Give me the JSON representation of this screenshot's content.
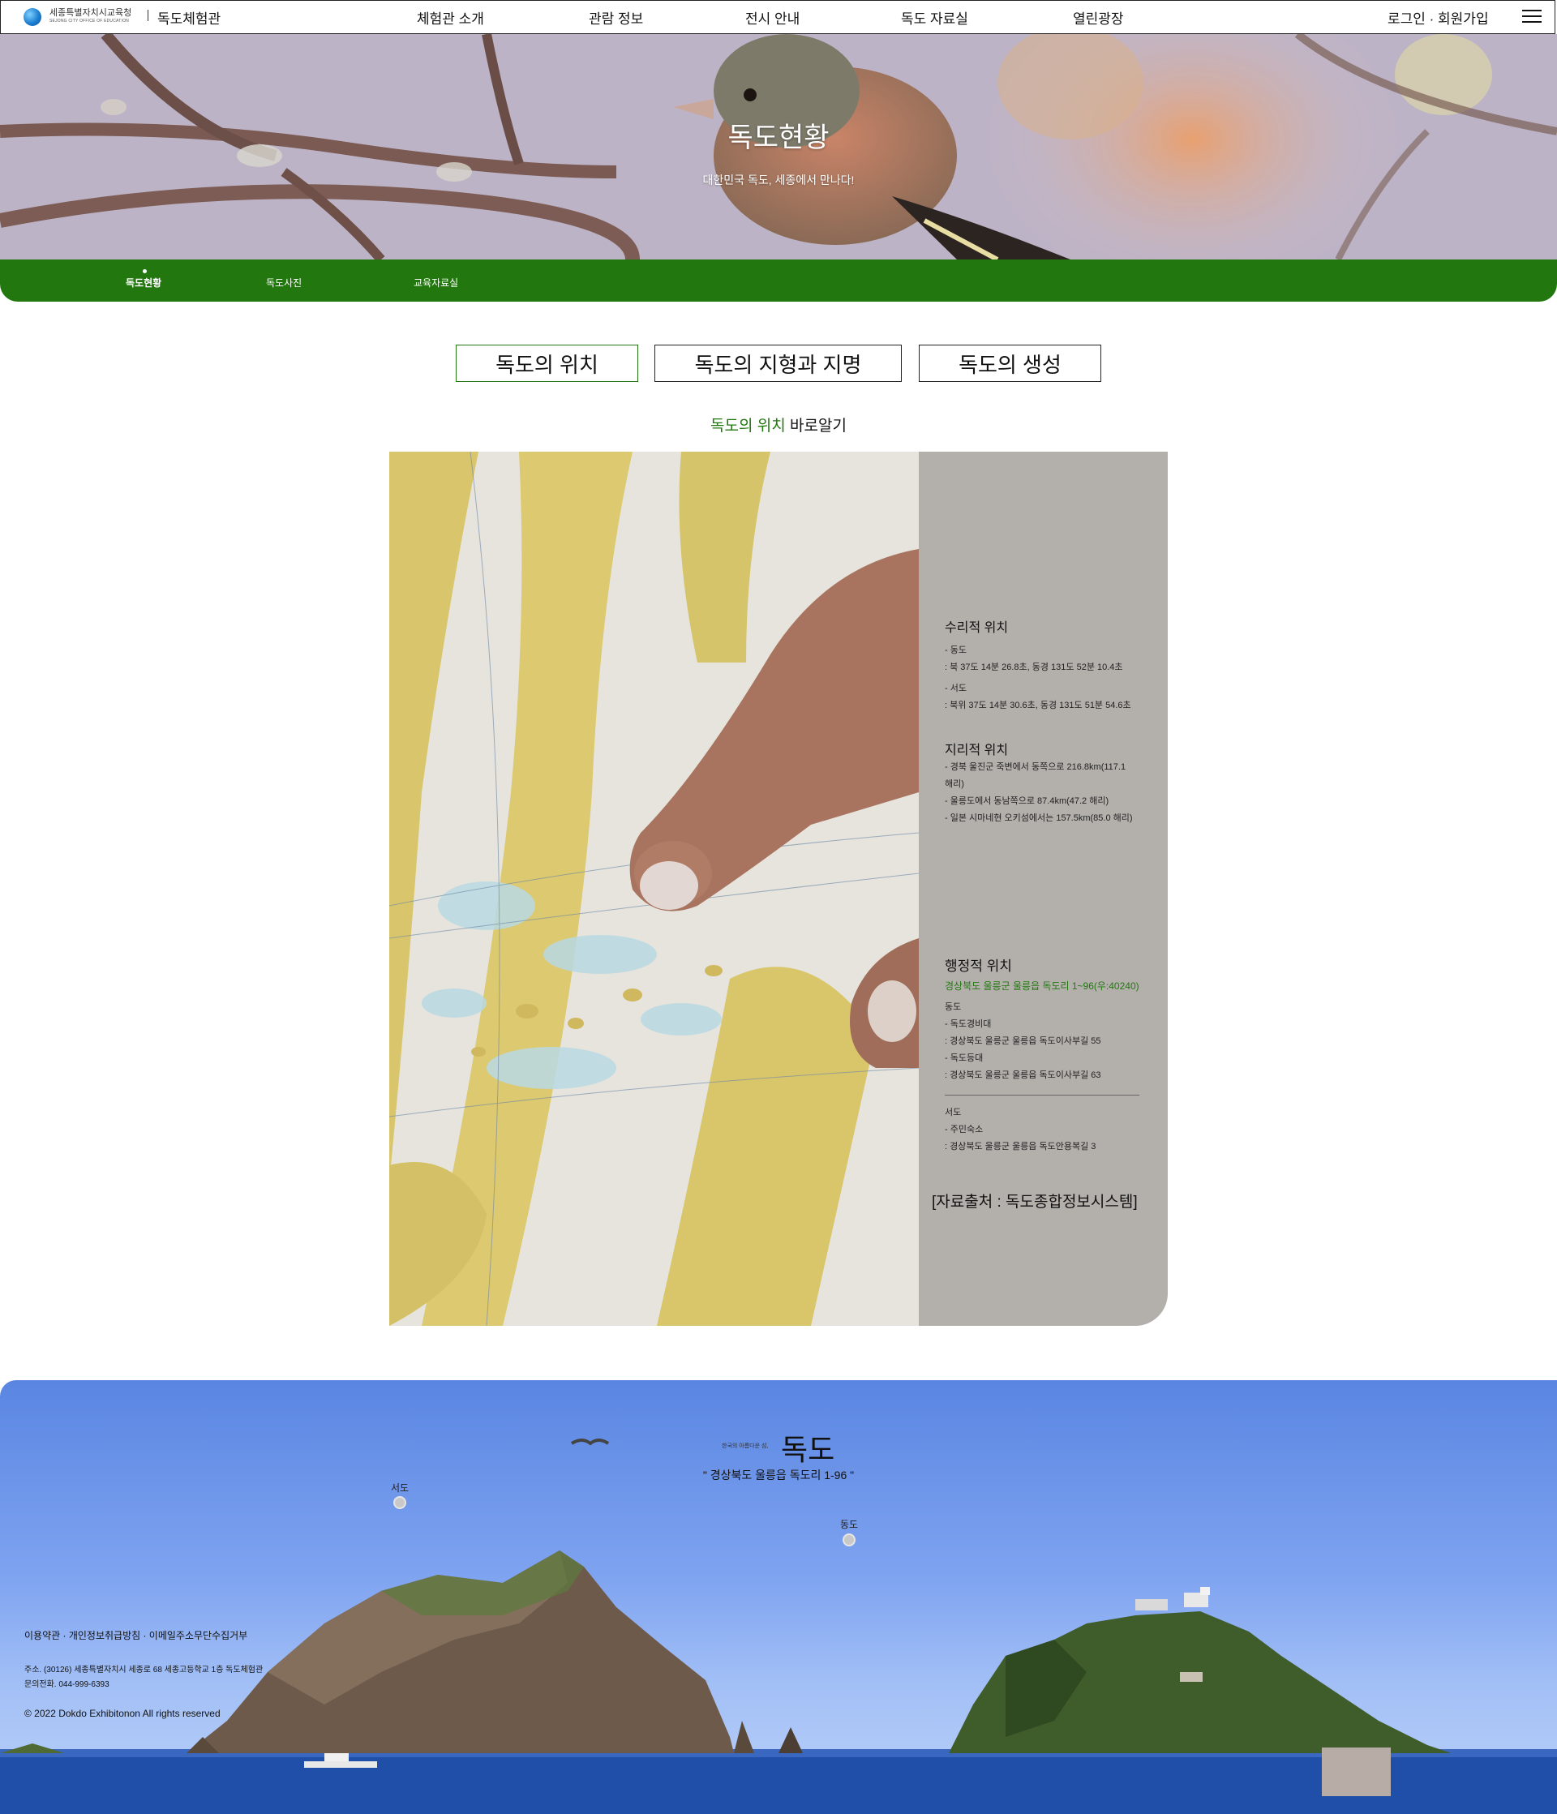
{
  "header": {
    "org_name": "세종특별자치시교육청",
    "org_name_en": "SEJONG CITY OFFICE OF EDUCATION",
    "site_name": "독도체험관",
    "nav": [
      {
        "label": "체험관 소개"
      },
      {
        "label": "관람 정보"
      },
      {
        "label": "전시 안내"
      },
      {
        "label": "독도 자료실"
      },
      {
        "label": "열린광장"
      }
    ],
    "auth_label": "로그인 · 회원가입",
    "menu_icon": "hamburger-menu-icon"
  },
  "banner": {
    "title": "독도현황",
    "subtitle": "대한민국 독도, 세종에서 만나다!"
  },
  "subnav": {
    "tabs": [
      {
        "label": "독도현황"
      },
      {
        "label": "독도사진"
      },
      {
        "label": "교육자료실"
      }
    ],
    "active": "독도현황"
  },
  "topics": [
    {
      "label": "독도의 위치"
    },
    {
      "label": "독도의 지형과 지명"
    },
    {
      "label": "독도의 생성"
    }
  ],
  "section": {
    "heading_accent": "독도의 위치",
    "heading_rest": "바로알기"
  },
  "info": {
    "math_title": "수리적 위치",
    "east_label": "- 동도",
    "east_coords": ": 북 37도 14분 26.8초, 동경 131도 52분 10.4초",
    "west_label": "- 서도",
    "west_coords": ": 북위 37도 14분 30.6초, 동경 131도 51분 54.6초",
    "geo_title": "지리적 위치",
    "geo_lines": [
      "- 경북 울진군 죽변에서 동쪽으로 216.8km(117.1",
      "해리)",
      "- 울릉도에서 동남쪽으로 87.4km(47.2 해리)",
      "- 일본 시마네현 오키섬에서는 157.5km(85.0 해리)"
    ],
    "admin_title": "행정적 위치",
    "admin_address": "경상북도 울릉군 울릉읍 독도리 1~96(우:40240)",
    "admin_east": [
      "동도",
      "- 독도경비대",
      ": 경상북도 울릉군 울릉읍 독도이사부길 55",
      "- 독도등대",
      ": 경상북도 울릉군 울릉읍 독도이사부길 63"
    ],
    "admin_west": [
      "서도",
      "- 주민숙소",
      ": 경상북도 울릉군 울릉읍 독도안용복길 3"
    ],
    "source": "[자료출처 : 독도종합정보시스템]"
  },
  "footer": {
    "eyebrow": "한국의 아름다운 섬,",
    "title": "독도",
    "address_quote": "\" 경상북도 울릉읍 독도리 1-96 \"",
    "marker_west": "서도",
    "marker_east": "동도",
    "links": "이용약관 · 개인정보취급방침 · 이메일주소무단수집거부",
    "address": "주소. (30126) 세종특별자치시 세종로 68 세종고등학교 1층 독도체험관",
    "phone": "문의전화. 044-999-6393",
    "copyright": "© 2022 Dokdo Exhibitonon All rights reserved"
  },
  "colors": {
    "brand_green": "#22780f",
    "info_panel": "#b3b0ac",
    "top_button": "#b8aca7"
  }
}
